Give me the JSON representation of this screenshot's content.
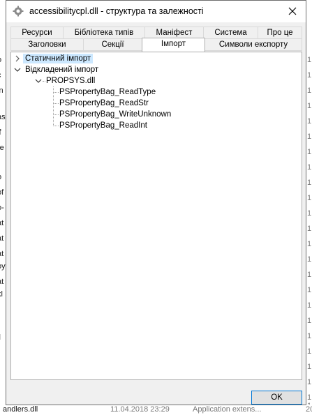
{
  "window": {
    "title": "accessibilitycpl.dll - структура та залежності"
  },
  "tabs_row1": [
    {
      "label": "Ресурси"
    },
    {
      "label": "Бібліотека типів"
    },
    {
      "label": "Маніфест"
    },
    {
      "label": "Система"
    },
    {
      "label": "Про це"
    }
  ],
  "tabs_row2": [
    {
      "label": "Заголовки"
    },
    {
      "label": "Секції"
    },
    {
      "label": "Імпорт",
      "active": true
    },
    {
      "label": "Символи експорту"
    }
  ],
  "tree": {
    "static_import": "Статичний імпорт",
    "delayed_import": "Відкладений імпорт",
    "dll": "PROPSYS.dll",
    "functions": [
      "PSPropertyBag_ReadType",
      "PSPropertyBag_ReadStr",
      "PSPropertyBag_WriteUnknown",
      "PSPropertyBag_ReadInt"
    ]
  },
  "buttons": {
    "ok": "OK"
  },
  "background": {
    "left_fragments": [
      "o",
      "c",
      "in",
      "as",
      "if",
      "re",
      "o",
      "of",
      "o-",
      "at",
      "at",
      "at",
      "oy",
      "at",
      "kl",
      "ll"
    ],
    "right_fragments": [
      "1",
      "1",
      "1",
      "1",
      "1",
      "1",
      "1",
      "1",
      "1",
      "1",
      "1",
      "1",
      "1",
      "1",
      "1",
      "1",
      "1",
      "1",
      "1",
      "1",
      "1",
      "1",
      "1",
      "1",
      "1"
    ],
    "bottom_row": {
      "name": "andlers.dll",
      "date": "11.04.2018 23:29",
      "type": "Application extens...",
      "size": "20"
    }
  },
  "colors": {
    "accent": "#0078d7",
    "selection": "#cce8ff",
    "dialog_bg": "#f0f0f0"
  }
}
